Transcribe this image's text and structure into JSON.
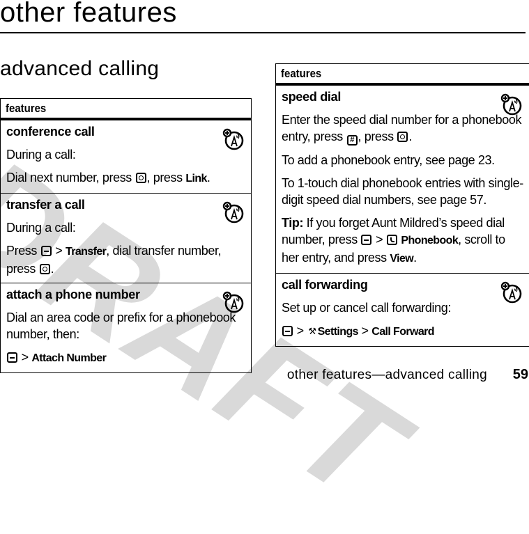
{
  "page": {
    "title": "other features",
    "section_title": "advanced calling",
    "watermark": "DRAFT",
    "footer": "other features—advanced calling",
    "page_number": "59"
  },
  "left_table": {
    "header": "features",
    "rows": [
      {
        "title": "conference call",
        "icon": "network-feature-icon",
        "paragraphs": [
          {
            "segments": [
              {
                "text": "During a call:"
              }
            ]
          },
          {
            "segments": [
              {
                "text": "Dial next number, press "
              },
              {
                "key": "center-key"
              },
              {
                "text": ", press "
              },
              {
                "cond": "Link"
              },
              {
                "text": "."
              }
            ]
          }
        ]
      },
      {
        "title": "transfer a call",
        "icon": "network-feature-icon",
        "paragraphs": [
          {
            "segments": [
              {
                "text": "During a call:"
              }
            ]
          },
          {
            "segments": [
              {
                "text": "Press "
              },
              {
                "key": "menu-key"
              },
              {
                "text": " > "
              },
              {
                "cond": "Transfer"
              },
              {
                "text": ", dial transfer number, press "
              },
              {
                "key": "center-key"
              },
              {
                "text": "."
              }
            ]
          }
        ]
      },
      {
        "title": "attach a phone number",
        "icon": "network-feature-icon",
        "paragraphs": [
          {
            "segments": [
              {
                "text": "Dial an area code or prefix for a phonebook number, then:"
              }
            ]
          },
          {
            "segments": [
              {
                "key": "menu-key"
              },
              {
                "text": " > "
              },
              {
                "cond": "Attach Number"
              }
            ]
          }
        ]
      }
    ]
  },
  "right_table": {
    "header": "features",
    "rows": [
      {
        "title": "speed dial",
        "icon": "network-feature-icon",
        "paragraphs": [
          {
            "segments": [
              {
                "text": "Enter the speed dial number for a phonebook entry, press "
              },
              {
                "key": "hash-key"
              },
              {
                "text": ", press "
              },
              {
                "key": "center-key"
              },
              {
                "text": "."
              }
            ]
          },
          {
            "segments": [
              {
                "text": "To add a phonebook entry, see page 23."
              }
            ]
          },
          {
            "segments": [
              {
                "text": "To 1-touch dial phonebook entries with single-digit speed dial numbers, see page 57."
              }
            ]
          },
          {
            "segments": [
              {
                "bold": "Tip:"
              },
              {
                "text": " If you forget Aunt Mildred’s speed dial number, press "
              },
              {
                "key": "menu-key"
              },
              {
                "text": " > "
              },
              {
                "key": "phonebook-icon"
              },
              {
                "text": " "
              },
              {
                "cond": "Phonebook"
              },
              {
                "text": ", scroll to her entry, and press "
              },
              {
                "cond": "View"
              },
              {
                "text": "."
              }
            ]
          }
        ]
      },
      {
        "title": "call forwarding",
        "icon": "network-feature-icon",
        "paragraphs": [
          {
            "segments": [
              {
                "text": "Set up or cancel call forwarding:"
              }
            ]
          },
          {
            "segments": [
              {
                "key": "menu-key"
              },
              {
                "text": " > "
              },
              {
                "key": "settings-icon"
              },
              {
                "cond": "Settings"
              },
              {
                "text": " > "
              },
              {
                "cond": "Call Forward"
              }
            ]
          }
        ]
      }
    ]
  }
}
